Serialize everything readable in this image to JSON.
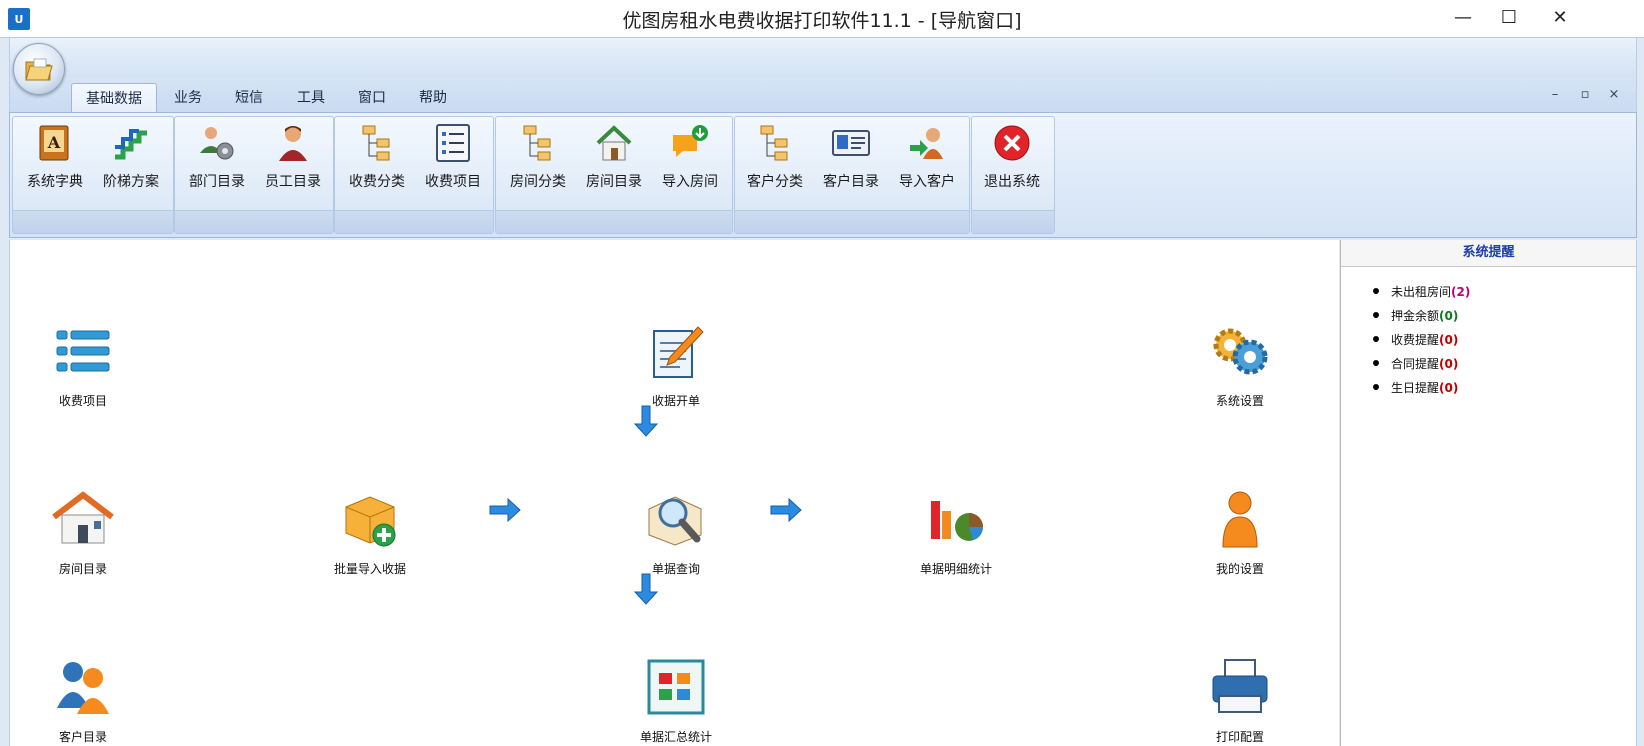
{
  "window": {
    "logo_text": "U",
    "title": "优图房租水电费收据打印软件11.1 - [导航窗口]",
    "minimize": "—",
    "maximize": "☐",
    "close": "✕"
  },
  "menu_tabs": [
    {
      "label": "基础数据"
    },
    {
      "label": "业务"
    },
    {
      "label": "短信"
    },
    {
      "label": "工具"
    },
    {
      "label": "窗口"
    },
    {
      "label": "帮助"
    }
  ],
  "mdi_controls": {
    "minimize": "–",
    "restore": "▫",
    "close": "×"
  },
  "ribbon": {
    "buttons": [
      {
        "label": "系统字典"
      },
      {
        "label": "阶梯方案"
      },
      {
        "label": "部门目录"
      },
      {
        "label": "员工目录"
      },
      {
        "label": "收费分类"
      },
      {
        "label": "收费项目"
      },
      {
        "label": "房间分类"
      },
      {
        "label": "房间目录"
      },
      {
        "label": "导入房间"
      },
      {
        "label": "客户分类"
      },
      {
        "label": "客户目录"
      },
      {
        "label": "导入客户"
      },
      {
        "label": "退出系统"
      }
    ]
  },
  "navigation": {
    "items": [
      {
        "label": "收费项目"
      },
      {
        "label": "收据开单"
      },
      {
        "label": "系统设置"
      },
      {
        "label": "房间目录"
      },
      {
        "label": "批量导入收据"
      },
      {
        "label": "单据查询"
      },
      {
        "label": "单据明细统计"
      },
      {
        "label": "我的设置"
      },
      {
        "label": "客户目录"
      },
      {
        "label": "单据汇总统计"
      },
      {
        "label": "打印配置"
      }
    ]
  },
  "reminders": {
    "title": "系统提醒",
    "items": [
      {
        "label": "未出租房间",
        "count": "(2)",
        "color": "#c0007a"
      },
      {
        "label": "押金余额",
        "count": "(0)",
        "color": "#0a7a1e"
      },
      {
        "label": "收费提醒",
        "count": "(0)",
        "color": "#c00000"
      },
      {
        "label": "合同提醒",
        "count": "(0)",
        "color": "#c00000"
      },
      {
        "label": "生日提醒",
        "count": "(0)",
        "color": "#c00000"
      }
    ]
  }
}
